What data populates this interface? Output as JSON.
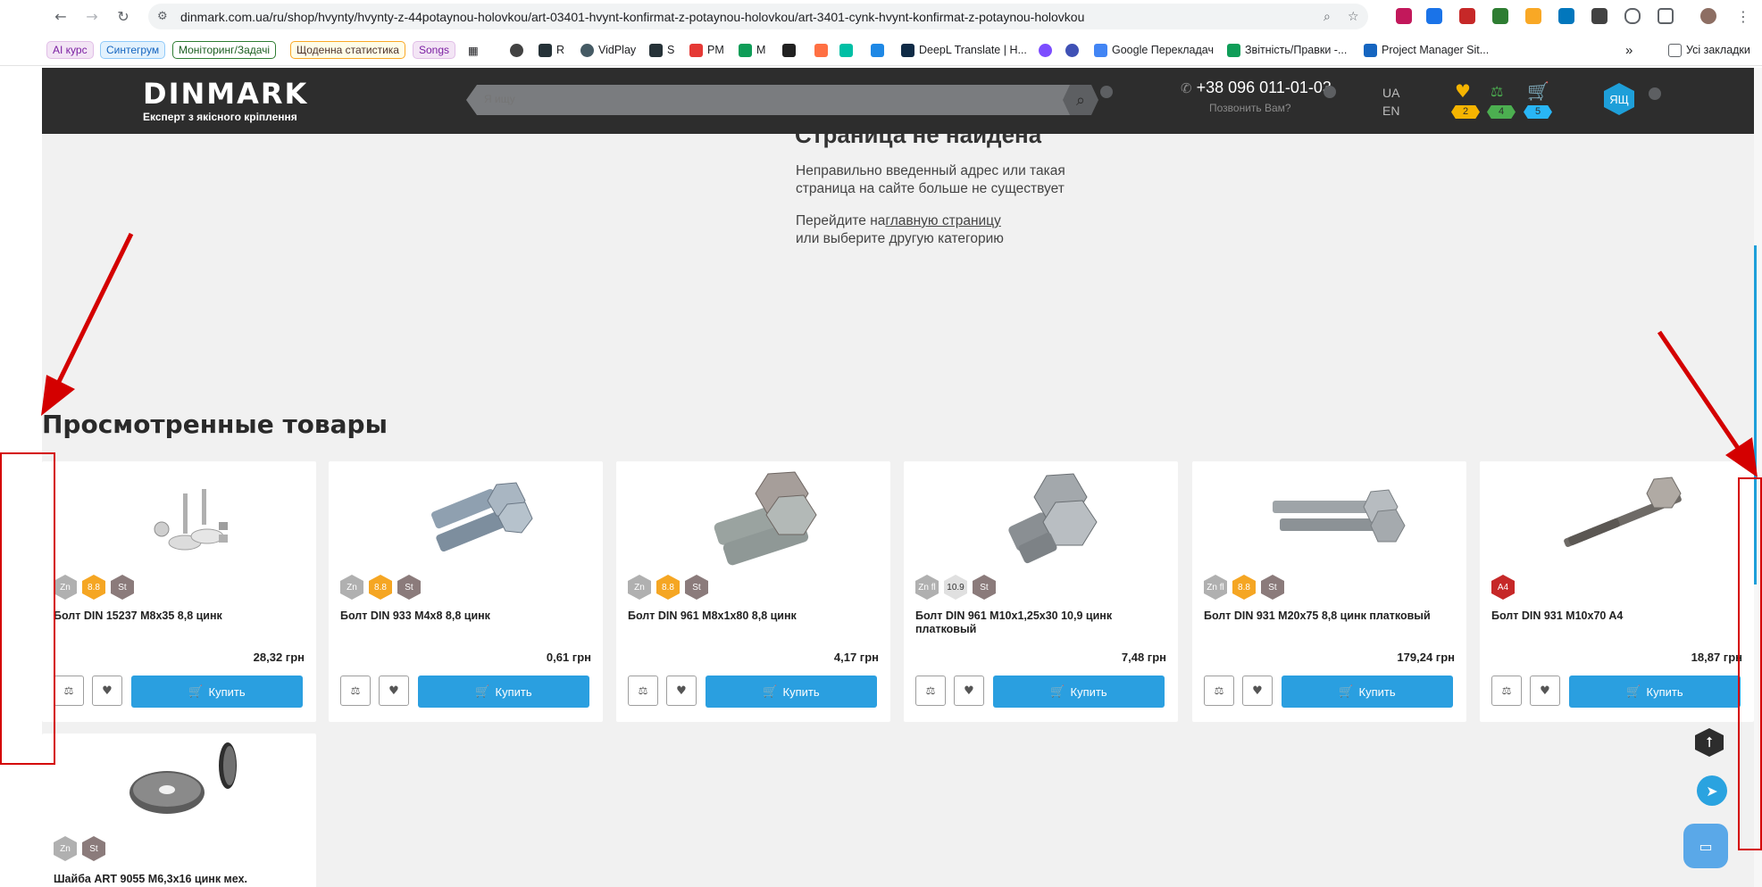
{
  "browser": {
    "url": "dinmark.com.ua/ru/shop/hvynty/hvynty-z-44potaynou-holovkou/art-03401-hvynt-konfirmat-z-potaynou-holovkou/art-3401-cynk-hvynt-konfirmat-z-potaynou-holovkou",
    "bookmarks": {
      "ai_course": "AI курс",
      "syntegrum": "Синтегрум",
      "monitoring": "Моніторинг/Задачі",
      "daily_stats": "Щоденна статистика",
      "songs": "Songs",
      "r": "R",
      "vidplay": "VidPlay",
      "s": "S",
      "pm": "PM",
      "m": "M",
      "deepl": "DeepL Translate | H...",
      "google_translate": "Google Перекладач",
      "reports": "Звітність/Правки -...",
      "project_manager": "Project Manager Sit...",
      "all_bookmarks": "Усі закладки"
    }
  },
  "header": {
    "logo": "DINMARK",
    "tagline": "Експерт з якісного кріплення",
    "search_placeholder": "Я ищу",
    "phone": "+38 096 011-01-03",
    "callback": "Позвонить Вам?",
    "lang_ua": "UA",
    "lang_en": "EN",
    "favorites_count": "2",
    "compare_count": "4",
    "cart_count": "5",
    "user_initials": "ЯЩ"
  },
  "not_found": {
    "title": "Страница не найдена",
    "line1": "Неправильно введенный адрес или такая",
    "line2": "страница на сайте больше не существует",
    "goto_prefix": "Перейдите на",
    "goto_link": "главную страницу",
    "line4": "или выберите другую категорию"
  },
  "viewed": {
    "title": "Просмотренные товары",
    "buy_label": "Купить",
    "products": [
      {
        "name": "Болт DIN 15237 M8x35 8,8 цинк",
        "price": "28,32 грн",
        "badges": [
          "Zn",
          "8.8",
          "St"
        ]
      },
      {
        "name": "Болт DIN 933 M4x8 8,8 цинк",
        "price": "0,61 грн",
        "badges": [
          "Zn",
          "8.8",
          "St"
        ]
      },
      {
        "name": "Болт DIN 961 M8x1x80 8,8 цинк",
        "price": "4,17 грн",
        "badges": [
          "Zn",
          "8.8",
          "St"
        ]
      },
      {
        "name": "Болт DIN 961 M10x1,25x30 10,9 цинк платковый",
        "price": "7,48 грн",
        "badges": [
          "Zn fl",
          "10.9",
          "St"
        ]
      },
      {
        "name": "Болт DIN 931 M20x75 8,8 цинк платковый",
        "price": "179,24 грн",
        "badges": [
          "Zn fl",
          "8.8",
          "St"
        ]
      },
      {
        "name": "Болт DIN 931 M10x70 A4",
        "price": "18,87 грн",
        "badges": [
          "A4"
        ]
      },
      {
        "name": "Шайба ART 9055 M6,3x16 цинк мех.",
        "price": "",
        "badges": [
          "Zn",
          "St"
        ]
      }
    ]
  }
}
